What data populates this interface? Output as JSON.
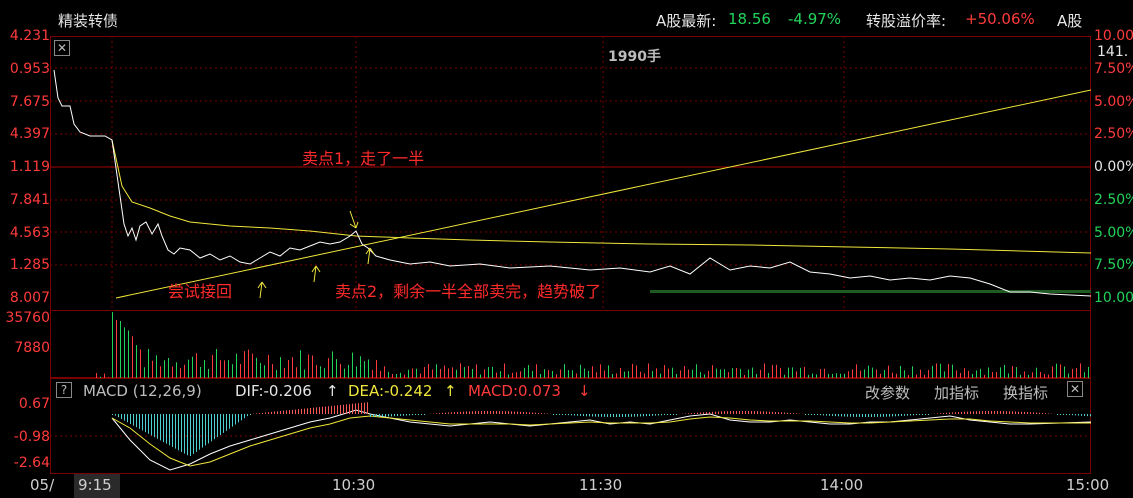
{
  "header": {
    "title": "精装转债",
    "a_share_label": "A股最新:",
    "a_share_price": "18.56",
    "a_share_change": "-4.97%",
    "premium_label": "转股溢价率:",
    "premium_value": "+50.06%",
    "a_share_btn": "A股"
  },
  "price_chart": {
    "volume_caption": "1990手",
    "right_top_label": "141.",
    "left_ticks": [
      "4.231",
      "0.953",
      "7.675",
      "4.397",
      "1.119",
      "7.841",
      "4.563",
      "1.285",
      "8.007"
    ],
    "right_ticks": [
      "10.00",
      "7.50%",
      "5.00%",
      "2.50%",
      "0.00%",
      "2.50%",
      "5.00%",
      "7.50%",
      "10.00"
    ],
    "annotations": {
      "sell1": "卖点1，走了一半",
      "try": "尝试接回",
      "sell2": "卖点2，剩余一半全部卖完，趋势破了"
    }
  },
  "volume_chart": {
    "ticks": [
      "35760",
      "7880"
    ]
  },
  "macd": {
    "help": "?",
    "name": "MACD (12,26,9)",
    "dif": "DIF:-0.206",
    "dif_arrow": "↑",
    "dea": "DEA:-0.242",
    "dea_arrow": "↑",
    "macd": "MACD:0.073",
    "macd_arrow": "↓",
    "btn_params": "改参数",
    "btn_add": "加指标",
    "btn_switch": "换指标",
    "ticks": [
      "0.67",
      "-0.98",
      "-2.64"
    ]
  },
  "xaxis": {
    "date": "05/",
    "labels": [
      "9:15",
      "10:30",
      "11:30",
      "14:00",
      "15:00"
    ]
  },
  "colors": {
    "up": "#ff3b3b",
    "down": "#22d35a",
    "dea": "#f0e63b",
    "price": "#ffffff"
  }
}
